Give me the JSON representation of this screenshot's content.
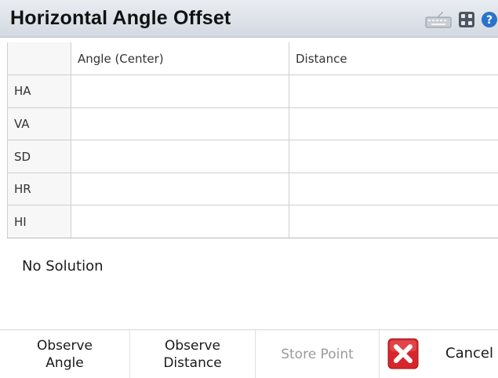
{
  "header": {
    "title": "Horizontal Angle Offset",
    "icons": [
      "keyboard-icon",
      "calculator-icon",
      "help-icon"
    ]
  },
  "table": {
    "columns": [
      "",
      "Angle (Center)",
      "Distance"
    ],
    "rows": [
      {
        "label": "HA",
        "angle": "",
        "distance": ""
      },
      {
        "label": "VA",
        "angle": "",
        "distance": ""
      },
      {
        "label": "SD",
        "angle": "",
        "distance": ""
      },
      {
        "label": "HR",
        "angle": "",
        "distance": ""
      },
      {
        "label": "HI",
        "angle": "",
        "distance": ""
      }
    ]
  },
  "status": {
    "text": "No Solution"
  },
  "footer": {
    "observe_angle": {
      "line1": "Observe",
      "line2": "Angle"
    },
    "observe_distance": {
      "line1": "Observe",
      "line2": "Distance"
    },
    "store_point": "Store Point",
    "cancel": "Cancel"
  },
  "colors": {
    "titlebar": "#dde2e8",
    "help_blue": "#2a73c9",
    "cancel_red": "#d7262b",
    "disabled_text": "#9a9a9a"
  }
}
